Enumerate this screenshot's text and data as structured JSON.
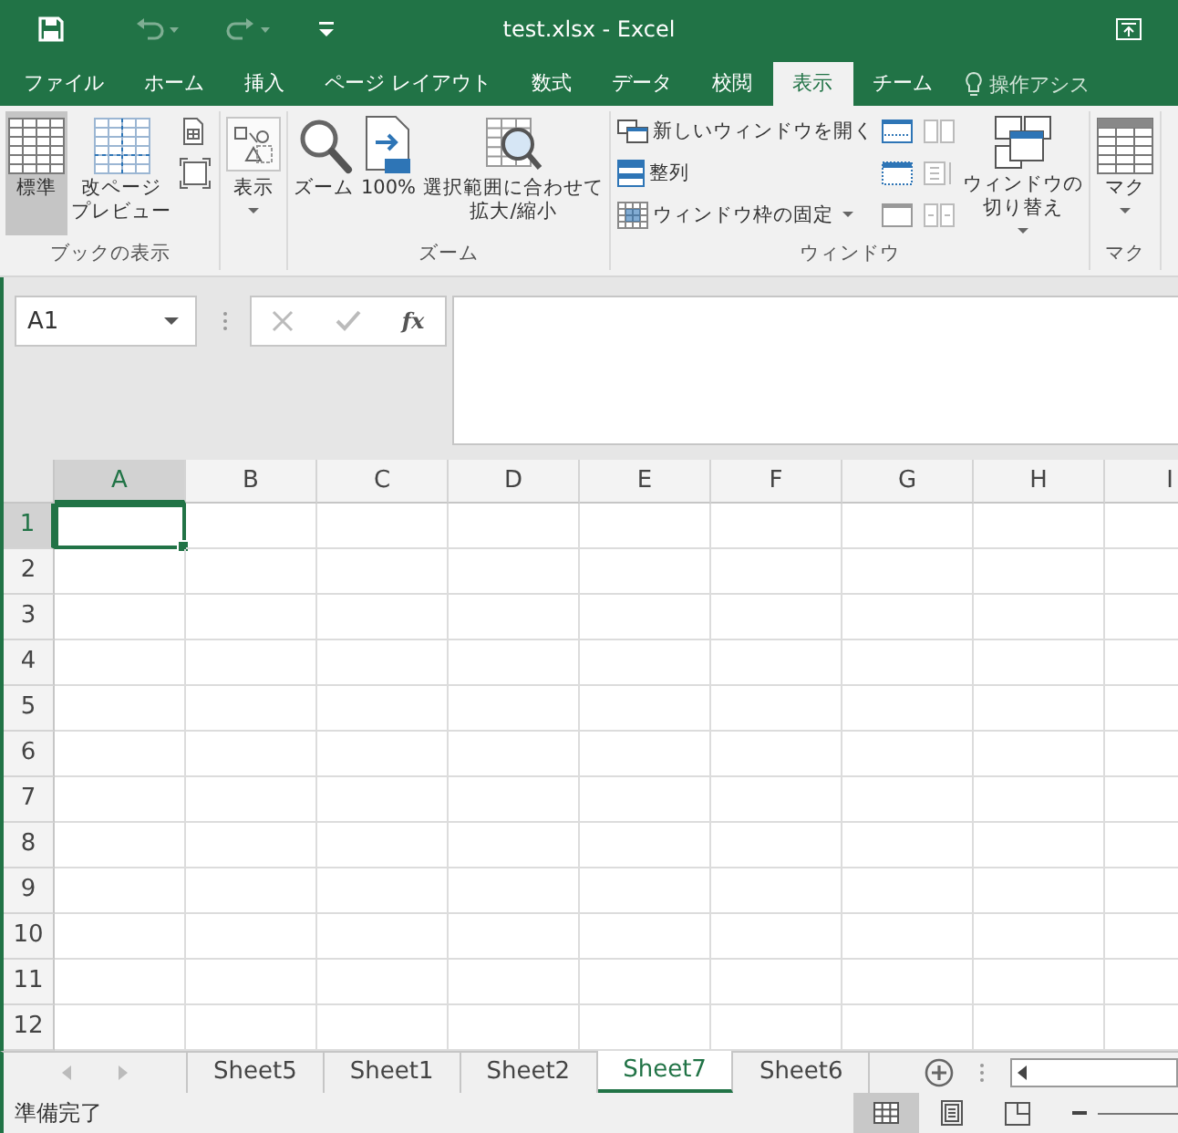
{
  "quick_access": [
    {
      "kind": "save",
      "disabled": false
    },
    {
      "kind": "undo",
      "disabled": true
    },
    {
      "kind": "redo",
      "disabled": true
    },
    {
      "kind": "customize",
      "disabled": false
    }
  ],
  "window": {
    "title": "test.xlsx - Excel"
  },
  "ribbon_tabs": [
    {
      "label": "ファイル",
      "selected": false
    },
    {
      "label": "ホーム",
      "selected": false
    },
    {
      "label": "挿入",
      "selected": false
    },
    {
      "label": "ページ レイアウト",
      "selected": false
    },
    {
      "label": "数式",
      "selected": false
    },
    {
      "label": "データ",
      "selected": false
    },
    {
      "label": "校閲",
      "selected": false
    },
    {
      "label": "表示",
      "selected": true
    },
    {
      "label": "チーム",
      "selected": false
    }
  ],
  "tell_me": {
    "placeholder": "操作アシス"
  },
  "ribbon_groups": [
    {
      "label": "ブックの表示",
      "columns": [
        [
          {
            "kind": "large",
            "label": "標準",
            "selected": true
          }
        ],
        [
          {
            "kind": "large",
            "lines": [
              "改ページ",
              "プレビュー"
            ],
            "selected": false
          }
        ],
        [
          {
            "kind": "icon",
            "selected": false
          },
          {
            "kind": "icon",
            "selected": false
          }
        ]
      ]
    },
    {
      "columns": [
        [
          {
            "kind": "large",
            "label": "表示",
            "dropdown": true,
            "boxed": true
          }
        ]
      ]
    },
    {
      "label": "ズーム",
      "columns": [
        [
          {
            "kind": "large",
            "label": "ズーム"
          }
        ],
        [
          {
            "kind": "large",
            "label": "100%"
          }
        ],
        [
          {
            "kind": "large",
            "lines": [
              "選択範囲に合わせて",
              "拡大/縮小"
            ]
          }
        ]
      ]
    },
    {
      "label": "ウィンドウ",
      "columns": [
        [
          {
            "kind": "small",
            "label": "新しいウィンドウを開く"
          },
          {
            "kind": "small",
            "label": "整列"
          },
          {
            "kind": "small",
            "label": "ウィンドウ枠の固定",
            "dropdown": true
          }
        ],
        [
          {
            "kind": "icon"
          },
          {
            "kind": "icon"
          },
          {
            "kind": "icon"
          }
        ],
        [
          {
            "kind": "icon",
            "disabled": true
          },
          {
            "kind": "icon",
            "disabled": true
          },
          {
            "kind": "icon",
            "disabled": true
          }
        ],
        [
          {
            "kind": "large",
            "lines": [
              "ウィンドウの",
              "切り替え"
            ],
            "dropdown": true
          }
        ]
      ]
    },
    {
      "label": "マク",
      "columns": [
        [
          {
            "kind": "large",
            "label": "マク",
            "dropdown": true
          }
        ]
      ]
    }
  ],
  "formula_bar": {
    "name_box": "A1",
    "function_label": "fx"
  },
  "columns": [
    {
      "label": "A",
      "selected": true
    },
    {
      "label": "B",
      "selected": false
    },
    {
      "label": "C",
      "selected": false
    },
    {
      "label": "D",
      "selected": false
    },
    {
      "label": "E",
      "selected": false
    },
    {
      "label": "F",
      "selected": false
    },
    {
      "label": "G",
      "selected": false
    },
    {
      "label": "H",
      "selected": false
    },
    {
      "label": "I",
      "selected": false
    }
  ],
  "rows": [
    {
      "label": "1",
      "selected": true
    },
    {
      "label": "2",
      "selected": false
    },
    {
      "label": "3",
      "selected": false
    },
    {
      "label": "4",
      "selected": false
    },
    {
      "label": "5",
      "selected": false
    },
    {
      "label": "6",
      "selected": false
    },
    {
      "label": "7",
      "selected": false
    },
    {
      "label": "8",
      "selected": false
    },
    {
      "label": "9",
      "selected": false
    },
    {
      "label": "10",
      "selected": false
    },
    {
      "label": "11",
      "selected": false
    },
    {
      "label": "12",
      "selected": false
    }
  ],
  "sheets": [
    {
      "label": "Sheet5",
      "selected": false
    },
    {
      "label": "Sheet1",
      "selected": false
    },
    {
      "label": "Sheet2",
      "selected": false
    },
    {
      "label": "Sheet7",
      "selected": true
    },
    {
      "label": "Sheet6",
      "selected": false
    }
  ],
  "status_bar": {
    "text": "準備完了",
    "views": [
      {
        "kind": "normal",
        "selected": true
      },
      {
        "kind": "page_layout",
        "selected": false
      },
      {
        "kind": "page_break",
        "selected": false
      }
    ]
  }
}
